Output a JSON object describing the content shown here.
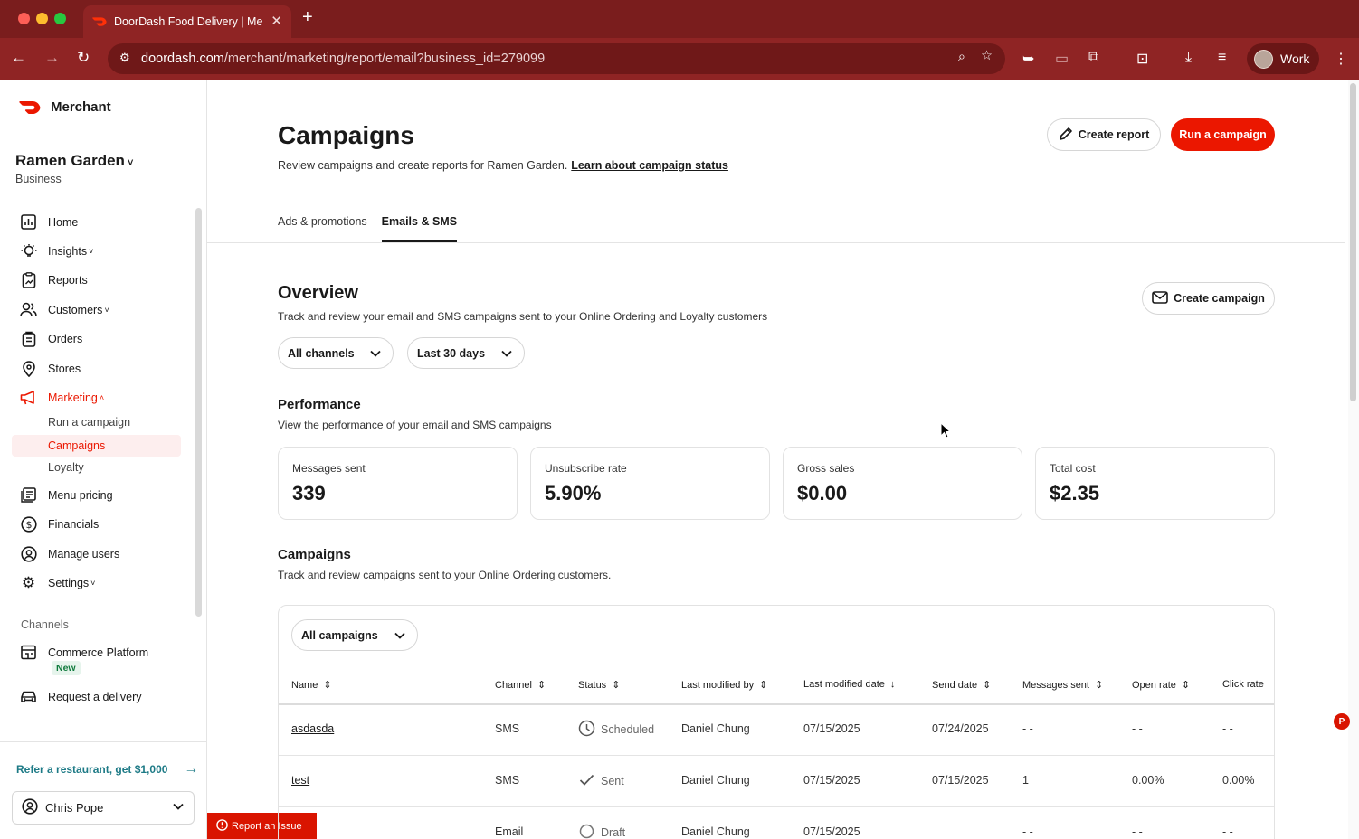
{
  "browser": {
    "tab_title": "DoorDash Food Delivery | Me",
    "url_host": "doordash.com",
    "url_path": "/merchant/marketing/report/email?business_id=279099",
    "profile_name": "Work"
  },
  "sidebar": {
    "brand": "Merchant",
    "business_name": "Ramen Garden",
    "business_type": "Business",
    "nav": [
      {
        "label": "Home",
        "icon": "chart-icon"
      },
      {
        "label": "Insights",
        "icon": "lightbulb-icon"
      },
      {
        "label": "Reports",
        "icon": "report-icon"
      },
      {
        "label": "Customers",
        "icon": "customers-icon"
      },
      {
        "label": "Orders",
        "icon": "orders-icon"
      },
      {
        "label": "Stores",
        "icon": "location-pin-icon"
      },
      {
        "label": "Marketing",
        "icon": "megaphone-icon"
      },
      {
        "label": "Menu pricing",
        "icon": "menu-icon"
      },
      {
        "label": "Financials",
        "icon": "dollar-icon"
      },
      {
        "label": "Manage users",
        "icon": "user-circle-icon"
      },
      {
        "label": "Settings",
        "icon": "gear-icon"
      }
    ],
    "marketing_sub": [
      "Run a campaign",
      "Campaigns",
      "Loyalty"
    ],
    "channels_label": "Channels",
    "channels": [
      {
        "label": "Commerce Platform",
        "badge": "New",
        "icon": "storefront-icon"
      },
      {
        "label": "Request a delivery",
        "icon": "car-icon"
      }
    ],
    "refer": "Refer a restaurant, get $1,000",
    "user": "Chris Pope",
    "report_issue": "Report an Issue"
  },
  "header": {
    "title": "Campaigns",
    "subtitle": "Review campaigns and create reports for Ramen Garden.",
    "learn_link": "Learn about campaign status",
    "create_report": "Create report",
    "run_campaign": "Run a campaign"
  },
  "tabs": [
    "Ads & promotions",
    "Emails & SMS"
  ],
  "overview": {
    "title": "Overview",
    "desc": "Track and review your email and SMS campaigns sent to your Online Ordering and Loyalty customers",
    "create_campaign": "Create campaign",
    "channel_filter": "All channels",
    "date_filter": "Last 30 days"
  },
  "performance": {
    "title": "Performance",
    "desc": "View the performance of your email and SMS campaigns",
    "cards": [
      {
        "label": "Messages sent",
        "value": "339"
      },
      {
        "label": "Unsubscribe rate",
        "value": "5.90%"
      },
      {
        "label": "Gross sales",
        "value": "$0.00"
      },
      {
        "label": "Total cost",
        "value": "$2.35"
      }
    ]
  },
  "campaigns": {
    "title": "Campaigns",
    "desc": "Track and review campaigns sent to your Online Ordering customers.",
    "filter": "All campaigns",
    "columns": [
      "Name",
      "Channel",
      "Status",
      "Last modified by",
      "Last modified date",
      "Send date",
      "Messages sent",
      "Open rate",
      "Click rate"
    ],
    "rows": [
      {
        "name": "asdasda",
        "channel": "SMS",
        "status": "Scheduled",
        "modified_by": "Daniel Chung",
        "modified_date": "07/15/2025",
        "send_date": "07/24/2025",
        "messages": "- -",
        "open": "- -",
        "click": "- -"
      },
      {
        "name": "test",
        "channel": "SMS",
        "status": "Sent",
        "modified_by": "Daniel Chung",
        "modified_date": "07/15/2025",
        "send_date": "07/15/2025",
        "messages": "1",
        "open": "0.00%",
        "click": "0.00%"
      },
      {
        "name": "",
        "channel": "Email",
        "status": "Draft",
        "modified_by": "Daniel Chung",
        "modified_date": "07/15/2025",
        "send_date": "",
        "messages": "- -",
        "open": "- -",
        "click": "- -"
      }
    ]
  },
  "colors": {
    "brand_red": "#eb1700",
    "chrome_red": "#8f2424"
  }
}
